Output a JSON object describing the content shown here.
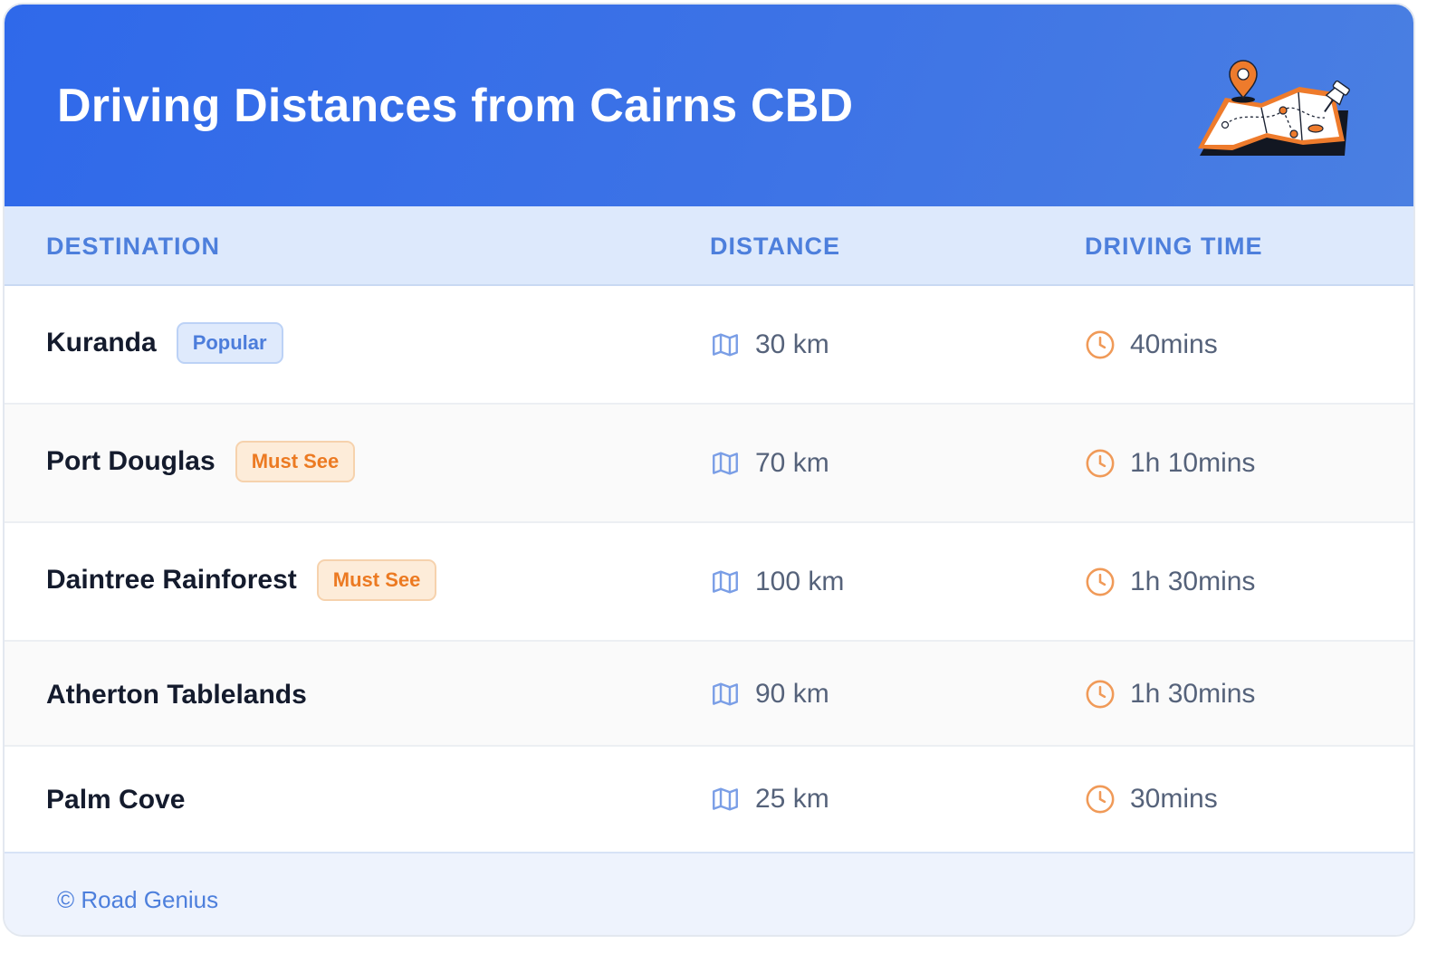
{
  "header": {
    "title": "Driving Distances from Cairns CBD",
    "illustration": "map-with-pins-icon",
    "gradient_start": "#2f69ea",
    "gradient_end": "#4a7fe2"
  },
  "table": {
    "columns": [
      "DESTINATION",
      "DISTANCE",
      "DRIVING TIME"
    ],
    "rows": [
      {
        "destination": "Kuranda",
        "badge": "Popular",
        "badge_type": "popular",
        "distance": "30 km",
        "time": "40mins"
      },
      {
        "destination": "Port Douglas",
        "badge": "Must See",
        "badge_type": "must",
        "distance": "70 km",
        "time": "1h 10mins"
      },
      {
        "destination": "Daintree Rainforest",
        "badge": "Must See",
        "badge_type": "must",
        "distance": "100 km",
        "time": "1h 30mins"
      },
      {
        "destination": "Atherton Tablelands",
        "badge": "",
        "badge_type": "",
        "distance": "90 km",
        "time": "1h 30mins"
      },
      {
        "destination": "Palm Cove",
        "badge": "",
        "badge_type": "",
        "distance": "25 km",
        "time": "30mins"
      }
    ],
    "distance_icon": "map-icon",
    "time_icon": "clock-icon"
  },
  "footer": {
    "copyright": "© Road Genius"
  },
  "colors": {
    "accent_blue": "#4d7fdc",
    "accent_orange": "#ec7a22",
    "header_row_bg": "#dde9fc",
    "footer_bg": "#eef3fd"
  }
}
